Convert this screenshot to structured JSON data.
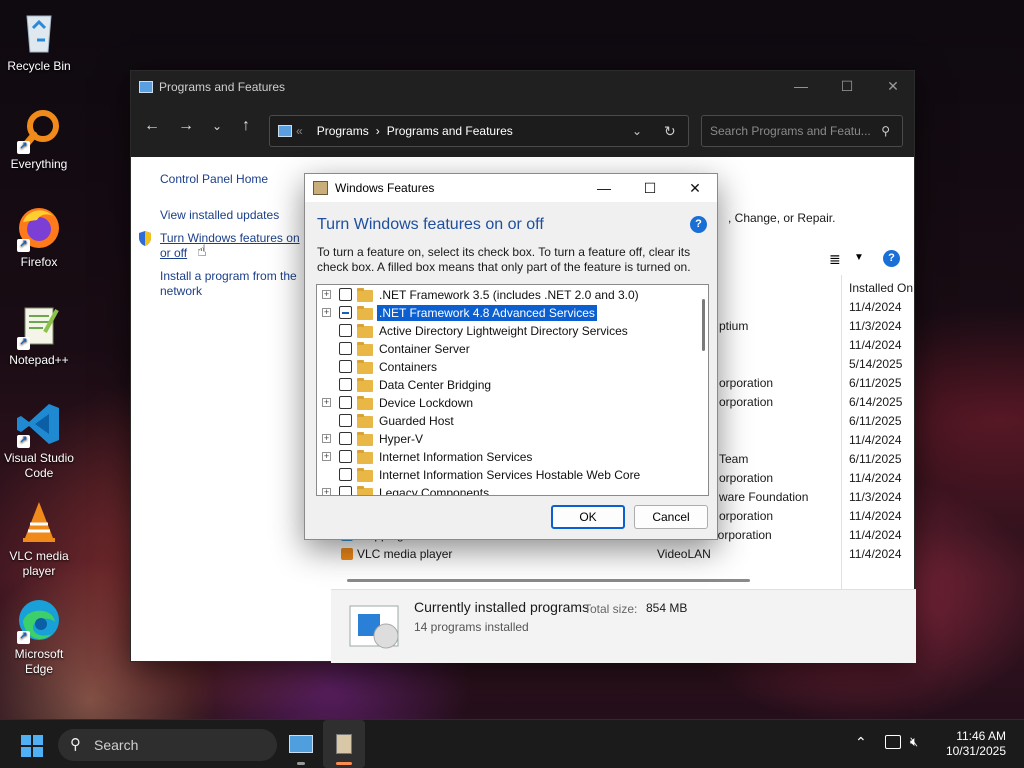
{
  "desktop": {
    "icons": [
      {
        "label": "Recycle Bin"
      },
      {
        "label": "Everything"
      },
      {
        "label": "Firefox"
      },
      {
        "label": "Notepad++"
      },
      {
        "label": "Visual Studio Code"
      },
      {
        "label": "VLC media player"
      },
      {
        "label": "Microsoft Edge"
      }
    ]
  },
  "explorer": {
    "title": "Programs and Features",
    "breadcrumb": [
      "Programs",
      "Programs and Features"
    ],
    "search_placeholder": "Search Programs and Featu...",
    "left_links": {
      "home": "Control Panel Home",
      "updates": "View installed updates",
      "features": "Turn Windows features on or off",
      "install": "Install a program from the network"
    },
    "header_text": ", Change, or Repair.",
    "column_installed_on": "Installed On",
    "rows": [
      {
        "name": "",
        "publisher": "",
        "date": "11/4/2024"
      },
      {
        "name": "",
        "publisher": "ptium",
        "date": "11/3/2024"
      },
      {
        "name": "",
        "publisher": "",
        "date": "11/4/2024"
      },
      {
        "name": "",
        "publisher": "",
        "date": "5/14/2025"
      },
      {
        "name": "",
        "publisher": "orporation",
        "date": "6/11/2025"
      },
      {
        "name": "",
        "publisher": "orporation",
        "date": "6/14/2025"
      },
      {
        "name": "",
        "publisher": "",
        "date": "6/11/2025"
      },
      {
        "name": "",
        "publisher": "",
        "date": "11/4/2024"
      },
      {
        "name": "",
        "publisher": "Team",
        "date": "6/11/2025"
      },
      {
        "name": "",
        "publisher": "orporation",
        "date": "11/4/2024"
      },
      {
        "name": "",
        "publisher": "ware Foundation",
        "date": "11/3/2024"
      },
      {
        "name": "",
        "publisher": "orporation",
        "date": "11/4/2024"
      },
      {
        "name": "Snipping Tool",
        "publisher": "Microsoft Corporation",
        "date": "11/4/2024"
      },
      {
        "name": "VLC media player",
        "publisher": "VideoLAN",
        "date": "11/4/2024"
      }
    ],
    "details": {
      "title": "Currently installed programs",
      "total_label": "Total size:",
      "total_value": "854 MB",
      "count": "14 programs installed"
    }
  },
  "dialog": {
    "title": "Windows Features",
    "heading": "Turn Windows features on or off",
    "description": "To turn a feature on, select its check box. To turn a feature off, clear its check box. A filled box means that only part of the feature is turned on.",
    "features": [
      {
        "label": ".NET Framework 3.5 (includes .NET 2.0 and 3.0)",
        "expandable": true,
        "state": "off",
        "selected": false
      },
      {
        "label": ".NET Framework 4.8 Advanced Services",
        "expandable": true,
        "state": "partial",
        "selected": true
      },
      {
        "label": "Active Directory Lightweight Directory Services",
        "expandable": false,
        "state": "off",
        "selected": false
      },
      {
        "label": "Container Server",
        "expandable": false,
        "state": "off",
        "selected": false
      },
      {
        "label": "Containers",
        "expandable": false,
        "state": "off",
        "selected": false
      },
      {
        "label": "Data Center Bridging",
        "expandable": false,
        "state": "off",
        "selected": false
      },
      {
        "label": "Device Lockdown",
        "expandable": true,
        "state": "off",
        "selected": false
      },
      {
        "label": "Guarded Host",
        "expandable": false,
        "state": "off",
        "selected": false
      },
      {
        "label": "Hyper-V",
        "expandable": true,
        "state": "off",
        "selected": false
      },
      {
        "label": "Internet Information Services",
        "expandable": true,
        "state": "off",
        "selected": false
      },
      {
        "label": "Internet Information Services Hostable Web Core",
        "expandable": false,
        "state": "off",
        "selected": false
      },
      {
        "label": "Legacy Components",
        "expandable": true,
        "state": "off",
        "selected": false
      }
    ],
    "ok_label": "OK",
    "cancel_label": "Cancel"
  },
  "taskbar": {
    "search_label": "Search",
    "time": "11:46 AM",
    "date": "10/31/2025"
  }
}
